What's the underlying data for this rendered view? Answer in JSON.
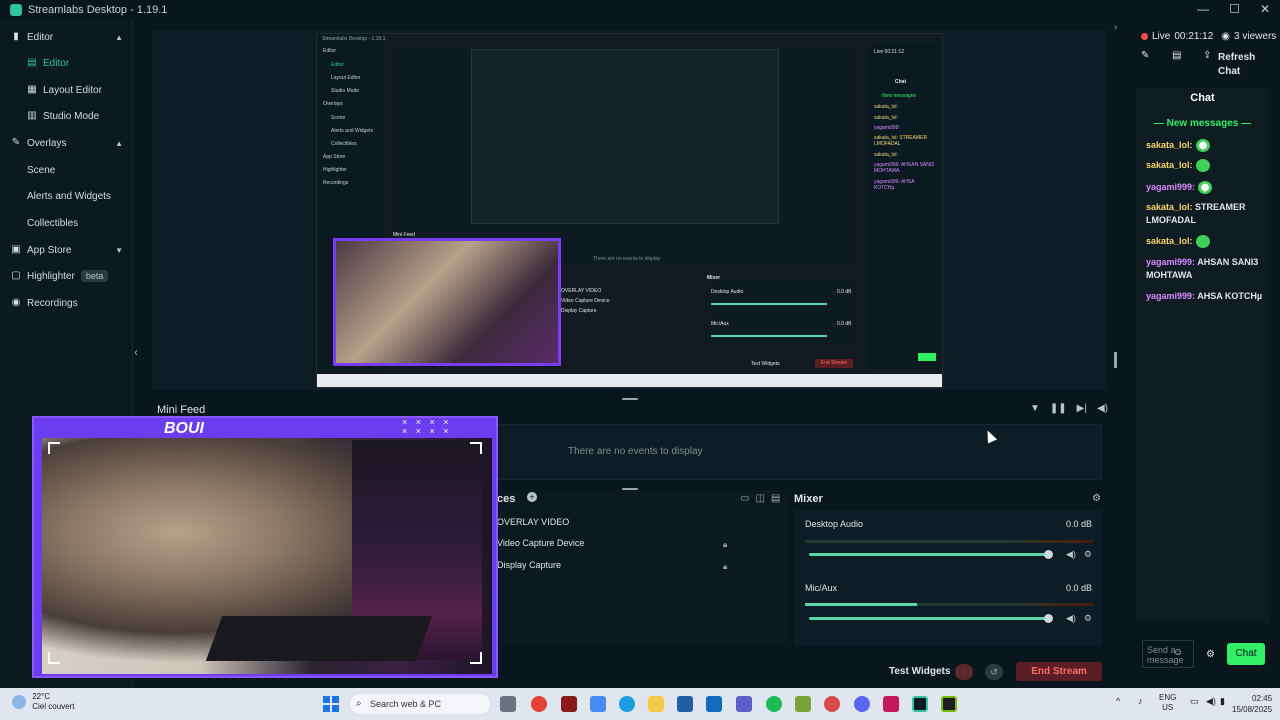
{
  "window": {
    "title": "Streamlabs Desktop - 1.19.1"
  },
  "sidebar": {
    "items": [
      {
        "label": "Editor",
        "icon": "editor-icon",
        "chevron": "up"
      },
      {
        "label": "Editor",
        "icon": "editor-icon",
        "active": true
      },
      {
        "label": "Layout Editor",
        "icon": "layout-icon"
      },
      {
        "label": "Studio Mode",
        "icon": "studio-icon"
      },
      {
        "label": "Overlays",
        "icon": "overlays-icon",
        "chevron": "up"
      },
      {
        "label": "Scene"
      },
      {
        "label": "Alerts and Widgets"
      },
      {
        "label": "Collectibles"
      },
      {
        "label": "App Store",
        "icon": "store-icon",
        "chevron": "down"
      },
      {
        "label": "Highlighter",
        "icon": "highlighter-icon",
        "badge": "beta"
      },
      {
        "label": "Recordings",
        "icon": "recordings-icon"
      }
    ]
  },
  "minifeed": {
    "title": "Mini Feed",
    "empty_text": "There are no events to display"
  },
  "sources": {
    "title": "ces",
    "items": [
      "OVERLAY VIDEO",
      "Video Capture Device",
      "Display Capture"
    ]
  },
  "mixer": {
    "title": "Mixer",
    "channels": [
      {
        "name": "Desktop Audio",
        "db": "0.0 dB",
        "level": 0.0,
        "volume": 1.0
      },
      {
        "name": "Mic/Aux",
        "db": "0.0 dB",
        "level": 0.39,
        "volume": 1.0
      }
    ]
  },
  "footer": {
    "test_widgets": "Test Widgets",
    "end_stream": "End Stream"
  },
  "webcam": {
    "banner": "BOUI",
    "stars": "× × × ×\n× × × ×"
  },
  "chat": {
    "live_label": "Live",
    "live_time": "00:21:12",
    "viewers": "3 viewers",
    "refresh": "Refresh",
    "refresh2": "Chat",
    "title": "Chat",
    "new_messages": "New messages",
    "messages": [
      {
        "user": "sakata_lol:",
        "text": "",
        "emote": "white"
      },
      {
        "user": "sakata_lol:",
        "text": "",
        "emote": "green"
      },
      {
        "user": "yagami999:",
        "text": "",
        "emote": "white"
      },
      {
        "user": "sakata_lol:",
        "text": "STREAMER LMOFADAL",
        "emote": ""
      },
      {
        "user": "sakata_lol:",
        "text": "",
        "emote": "green"
      },
      {
        "user": "yagami999:",
        "text": "AHSAN SANI3 MOHTAWA",
        "emote": ""
      },
      {
        "user": "yagami999:",
        "text": "AHSA KOTCHµ",
        "emote": ""
      }
    ],
    "send_placeholder": "Send a message",
    "chat_button": "Chat"
  },
  "nested_preview": {
    "title": "Streamlabs Desktop - 1.19.1",
    "nav": [
      "Editor",
      "Editor",
      "Layout Editor",
      "Studio Mode",
      "Overlays",
      "Scene",
      "Alerts and Widgets",
      "Collectibles",
      "App Store",
      "Highlighter",
      "Recordings"
    ],
    "empty_text": "There are no events to display",
    "mini_feed": "Mini Feed",
    "mixer": "Mixer",
    "desktop_audio": "Desktop Audio",
    "mic_aux": "Mic/Aux",
    "db": "0.0 dB",
    "sources": [
      "OVERLAY VIDEO",
      "Video Capture Device",
      "Display Capture"
    ],
    "test_widgets": "Test Widgets",
    "end_stream": "End Stream",
    "live": "Live 00:21:12",
    "chat": "Chat",
    "new_messages": "New messages",
    "chat_lines": [
      "sakata_lol:",
      "sakata_lol:",
      "yagami999:",
      "sakata_lol: STREAMER LMOFADAL",
      "sakata_lol:",
      "yagami999: AHSAN SANI3 MOHTAWA",
      "yagami999: AHSA KOTCHµ"
    ]
  },
  "taskbar": {
    "weather_temp": "22°C",
    "weather_desc": "Ciel couvert",
    "search_placeholder": "Search web & PC",
    "lang1": "ENG",
    "lang2": "US",
    "time": "02:45",
    "date": "15/08/2025"
  },
  "colors": {
    "accent": "#31c3a2",
    "chat_green": "#31f067",
    "end_stream": "#ff6b6b",
    "overlay_purple": "#6b3df0"
  }
}
